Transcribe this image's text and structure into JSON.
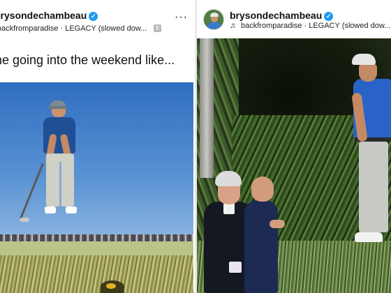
{
  "left_post": {
    "username": "brysondechambeau",
    "audio": "backfromparadise · LEGACY (slowed dow...",
    "explicit_badge": "E",
    "more_label": "···",
    "caption": "me going into the weekend like..."
  },
  "right_post": {
    "username": "brysondechambeau",
    "audio": "backfromparadise · LEGACY (slowed dow...",
    "music_icon": "♫"
  },
  "icons": {
    "verified": "✓",
    "verified_name": "verified-badge-icon",
    "music_name": "music-note-icon",
    "more_name": "more-options-icon"
  },
  "colors": {
    "verified_blue": "#1d9bf0",
    "text": "#111111"
  }
}
